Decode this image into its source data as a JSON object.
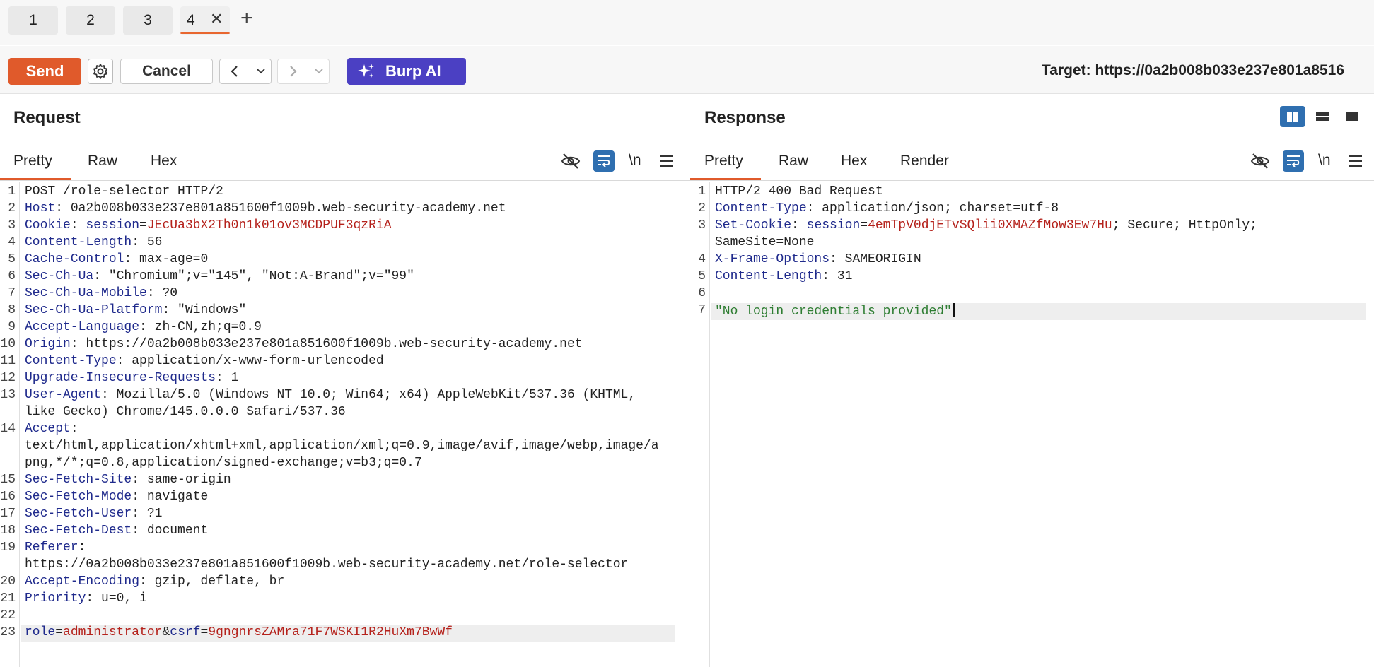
{
  "tabs": [
    {
      "label": "1"
    },
    {
      "label": "2"
    },
    {
      "label": "3"
    },
    {
      "label": "4",
      "active": true
    }
  ],
  "toolbar": {
    "send_label": "Send",
    "cancel_label": "Cancel",
    "burp_ai_label": "Burp AI",
    "target_text": "Target: https://0a2b008b033e237e801a8516"
  },
  "request": {
    "title": "Request",
    "tabs": [
      "Pretty",
      "Raw",
      "Hex"
    ],
    "newline_label": "\\n",
    "line_numbers": [
      "1",
      "2",
      "3",
      "4",
      "5",
      "6",
      "7",
      "8",
      "9",
      "10",
      "11",
      "12",
      "13",
      "14",
      "15",
      "16",
      "17",
      "18",
      "19",
      "20",
      "21",
      "22",
      "23"
    ],
    "lines": {
      "l1": "POST /role-selector HTTP/2",
      "l2_key": "Host",
      "l2_val": " 0a2b008b033e237e801a851600f1009b.web-security-academy.net",
      "l3_key": "Cookie",
      "l3_ck": "session",
      "l3_cv": "JEcUa3bX2Th0n1k01ov3MCDPUF3qzRiA",
      "l4_key": "Content-Length",
      "l4_val": " 56",
      "l5_key": "Cache-Control",
      "l5_val": " max-age=0",
      "l6_key": "Sec-Ch-Ua",
      "l6_val": " \"Chromium\";v=\"145\", \"Not:A-Brand\";v=\"99\"",
      "l7_key": "Sec-Ch-Ua-Mobile",
      "l7_val": " ?0",
      "l8_key": "Sec-Ch-Ua-Platform",
      "l8_val": " \"Windows\"",
      "l9_key": "Accept-Language",
      "l9_val": " zh-CN,zh;q=0.9",
      "l10_key": "Origin",
      "l10_val": " https://0a2b008b033e237e801a851600f1009b.web-security-academy.net",
      "l11_key": "Content-Type",
      "l11_val": " application/x-www-form-urlencoded",
      "l12_key": "Upgrade-Insecure-Requests",
      "l12_val": " 1",
      "l13_key": "User-Agent",
      "l13_val": " Mozilla/5.0 (Windows NT 10.0; Win64; x64) AppleWebKit/537.36 (KHTML,",
      "l13_cont": "like Gecko) Chrome/145.0.0.0 Safari/537.36",
      "l14_key": "Accept",
      "l14_cont1": "text/html,application/xhtml+xml,application/xml;q=0.9,image/avif,image/webp,image/a",
      "l14_cont2": "png,*/*;q=0.8,application/signed-exchange;v=b3;q=0.7",
      "l15_key": "Sec-Fetch-Site",
      "l15_val": " same-origin",
      "l16_key": "Sec-Fetch-Mode",
      "l16_val": " navigate",
      "l17_key": "Sec-Fetch-User",
      "l17_val": " ?1",
      "l18_key": "Sec-Fetch-Dest",
      "l18_val": " document",
      "l19_key": "Referer",
      "l19_cont": "https://0a2b008b033e237e801a851600f1009b.web-security-academy.net/role-selector",
      "l20_key": "Accept-Encoding",
      "l20_val": " gzip, deflate, br",
      "l21_key": "Priority",
      "l21_val": " u=0, i",
      "l23_p1k": "role",
      "l23_p1v": "administrator",
      "l23_p2k": "csrf",
      "l23_p2v": "9gngnrsZAMra71F7WSKI1R2HuXm7BwWf"
    }
  },
  "response": {
    "title": "Response",
    "tabs": [
      "Pretty",
      "Raw",
      "Hex",
      "Render"
    ],
    "newline_label": "\\n",
    "line_numbers": [
      "1",
      "2",
      "3",
      "4",
      "5",
      "6",
      "7"
    ],
    "lines": {
      "l1": "HTTP/2 400 Bad Request",
      "l2_key": "Content-Type",
      "l2_val": " application/json; charset=utf-8",
      "l3_key": "Set-Cookie",
      "l3_ck": "session",
      "l3_cv": "4emTpV0djETvSQlii0XMAZfMow3Ew7Hu",
      "l3_rest": "; Secure; HttpOnly;",
      "l3_cont": "SameSite=None",
      "l4_key": "X-Frame-Options",
      "l4_val": " SAMEORIGIN",
      "l5_key": "Content-Length",
      "l5_val": " 31",
      "l7": "\"No login credentials provided\""
    }
  },
  "colors": {
    "send": "#e05a2b",
    "burp_ai": "#4b40c3",
    "header_key": "#1f2a8c",
    "cookie_value": "#b5221c",
    "json_string": "#2e7d32",
    "active_view": "#2f6fb0"
  },
  "icons": [
    "settings-gear-icon",
    "chevron-left-icon",
    "chevron-down-icon",
    "chevron-right-icon",
    "sparkle-icon",
    "eye-off-icon",
    "word-wrap-icon",
    "menu-icon",
    "close-icon",
    "plus-icon",
    "split-horizontal-icon",
    "split-vertical-icon",
    "single-pane-icon"
  ]
}
